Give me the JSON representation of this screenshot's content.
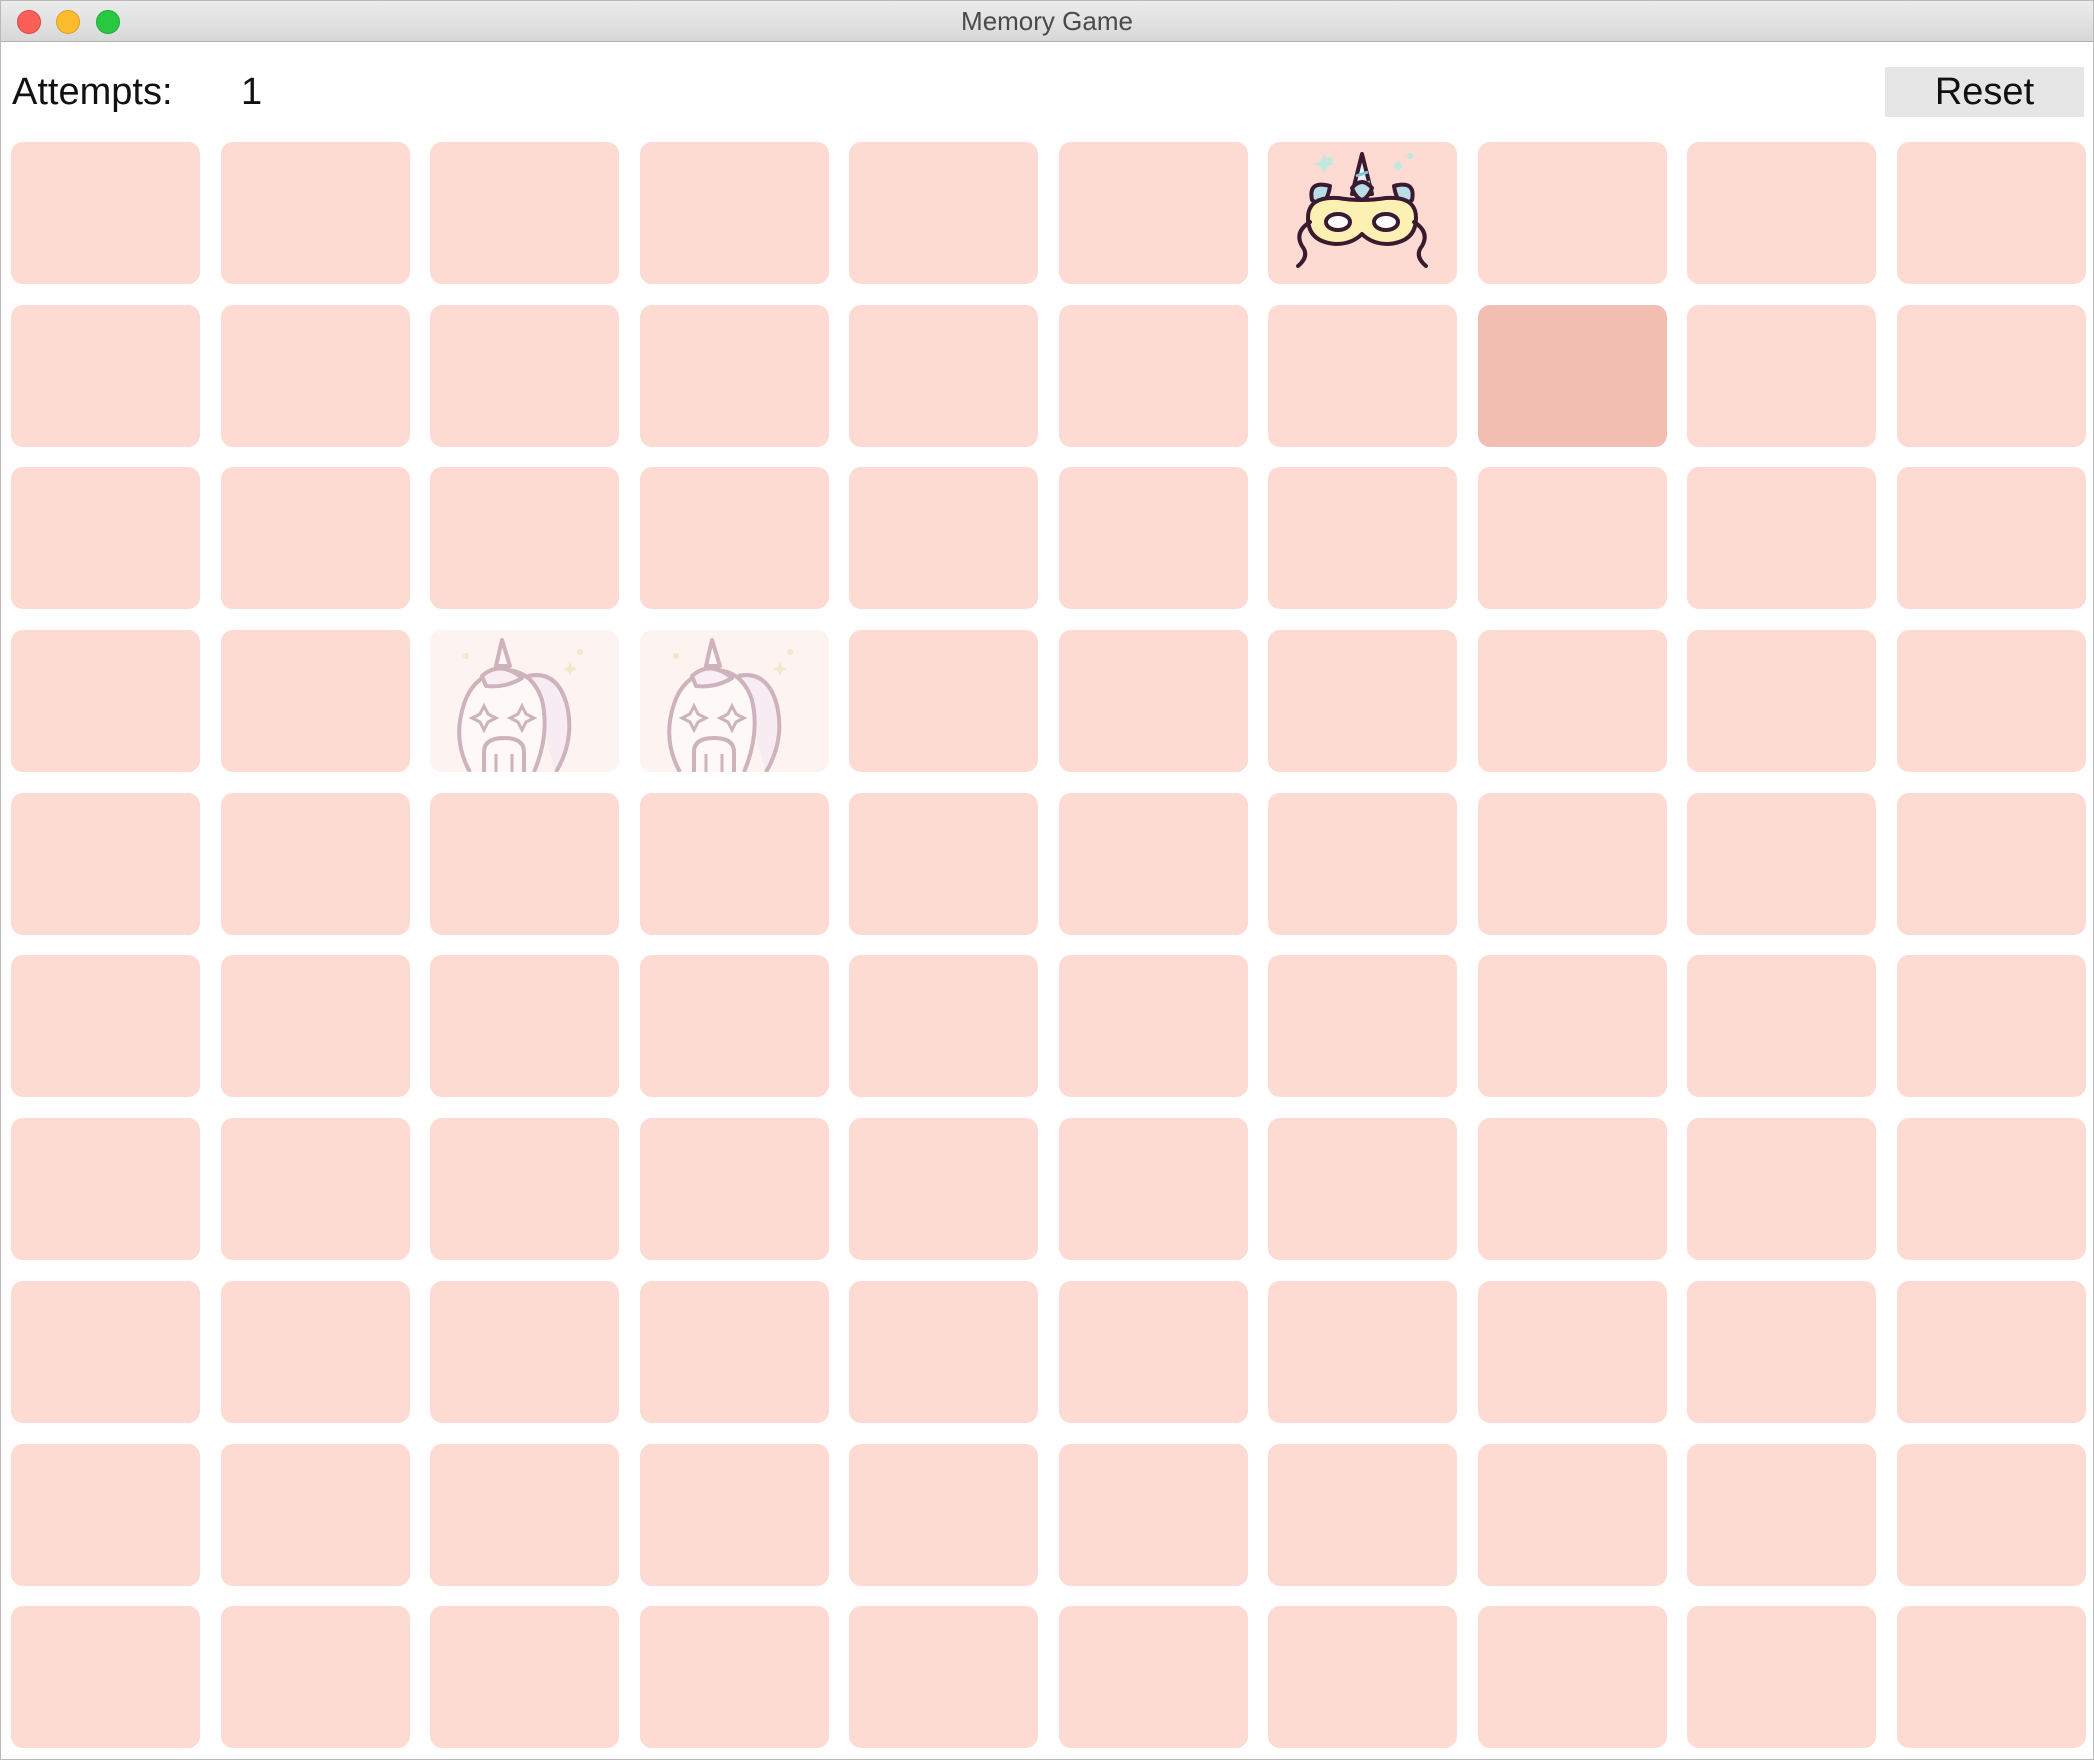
{
  "window": {
    "title": "Memory Game",
    "controls": [
      "close",
      "minimize",
      "zoom"
    ]
  },
  "header": {
    "attempts_label": "Attempts:",
    "attempts_value": "1",
    "reset_label": "Reset"
  },
  "board": {
    "columns": 10,
    "rows": 10,
    "card_back_color": "#fddad2",
    "selected_color": "#f2beb2",
    "matched_color": "#fdf3f1",
    "face_up": [
      {
        "row": 1,
        "col": 7,
        "icon": "unicorn-mask-icon",
        "state": "revealed"
      }
    ],
    "selected": [
      {
        "row": 2,
        "col": 8
      }
    ],
    "matched": [
      {
        "row": 4,
        "col": 3,
        "icon": "unicorn-face-icon",
        "state": "matched"
      },
      {
        "row": 4,
        "col": 4,
        "icon": "unicorn-face-icon",
        "state": "matched"
      }
    ]
  }
}
